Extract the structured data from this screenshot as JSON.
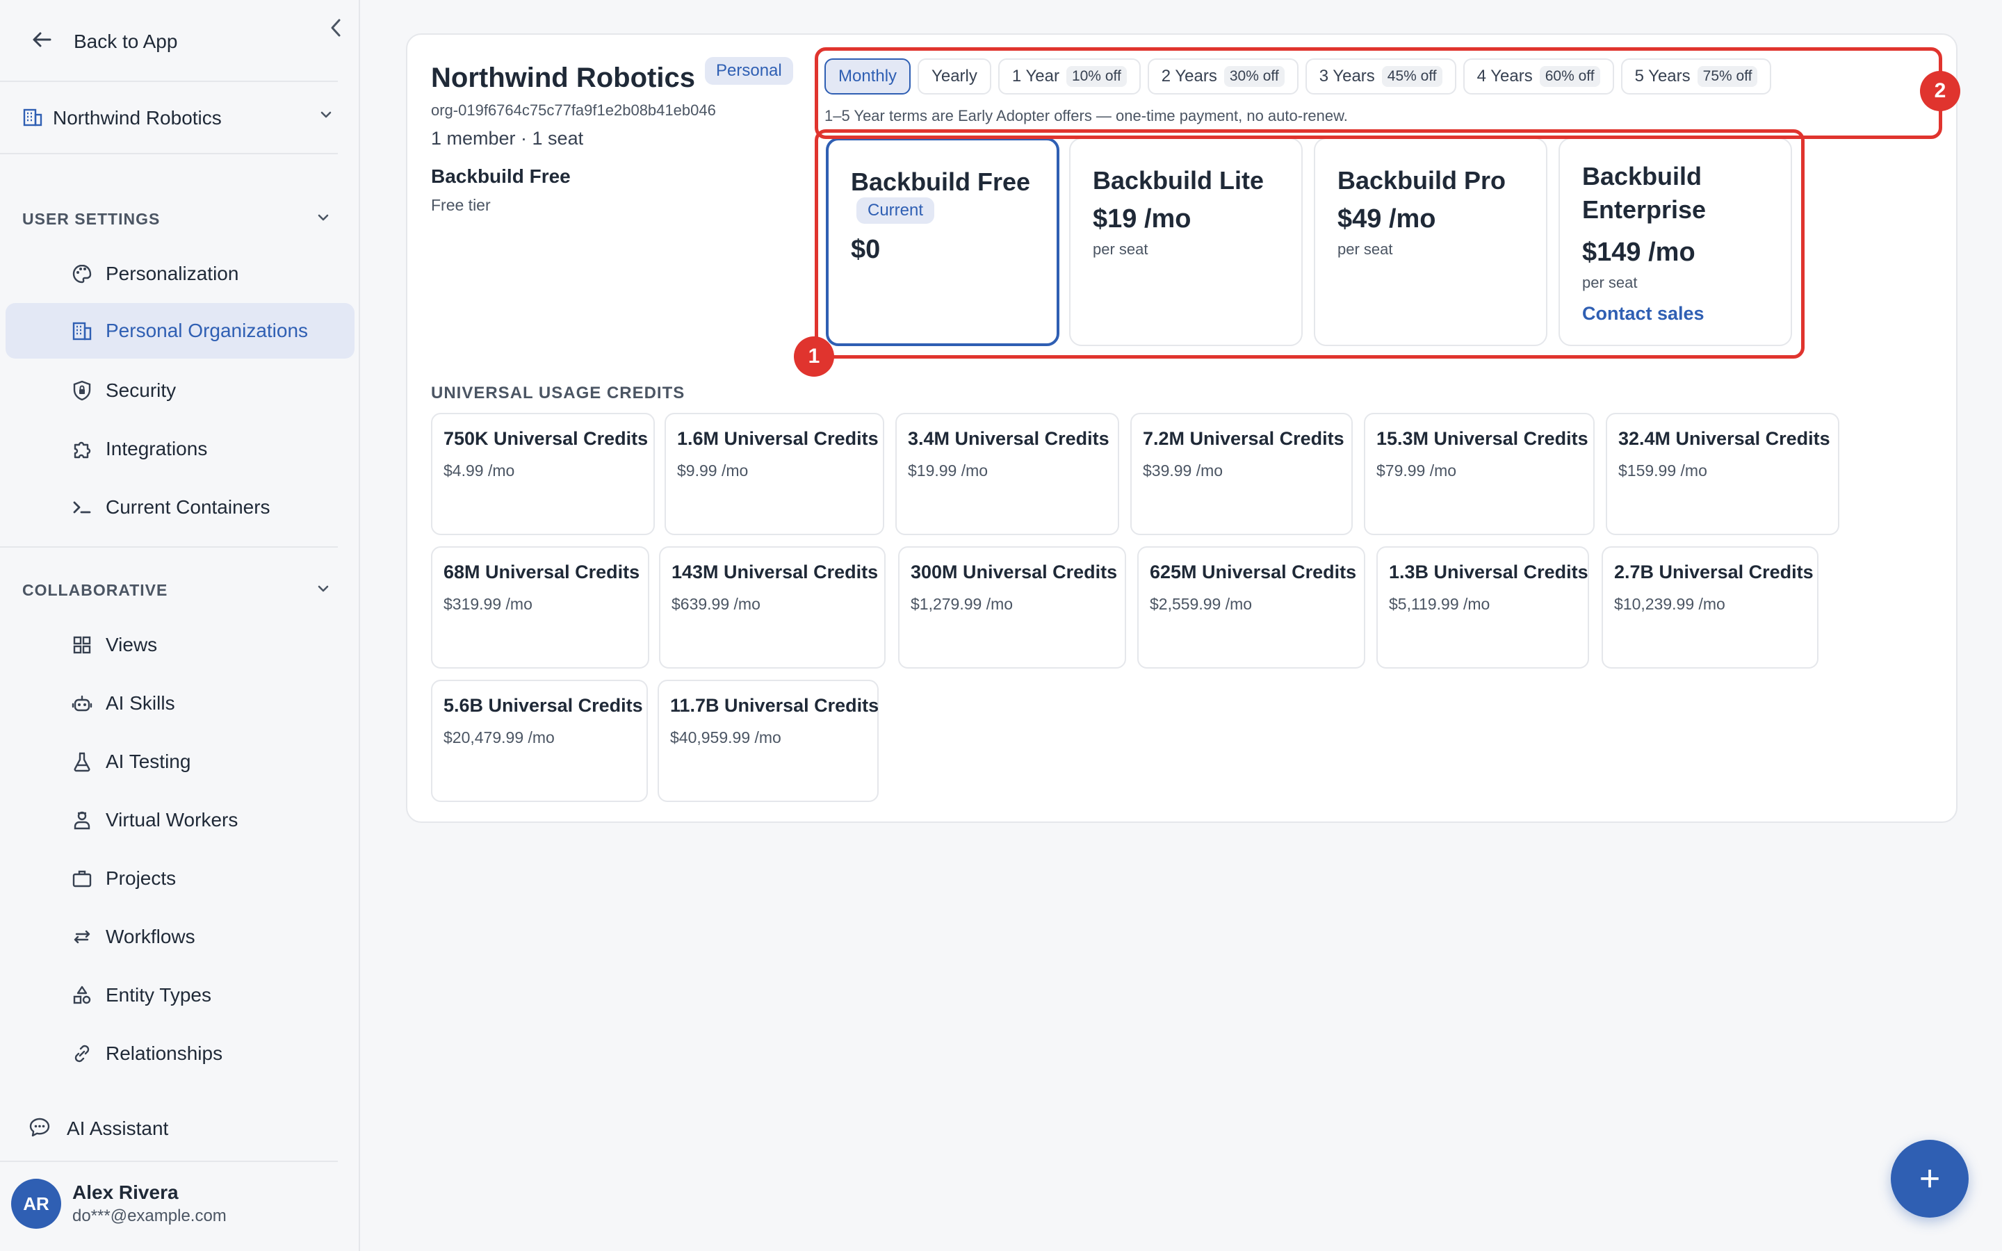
{
  "sidebar": {
    "back_label": "Back to App",
    "org_selector": "Northwind Robotics",
    "user_settings_head": "USER SETTINGS",
    "user_items": [
      {
        "label": "Personalization",
        "icon": "palette-icon"
      },
      {
        "label": "Personal Organizations",
        "icon": "building-icon"
      },
      {
        "label": "Security",
        "icon": "shield-icon"
      },
      {
        "label": "Integrations",
        "icon": "puzzle-icon"
      },
      {
        "label": "Current Containers",
        "icon": "terminal-icon"
      }
    ],
    "collab_head": "COLLABORATIVE",
    "collab_items": [
      {
        "label": "Views",
        "icon": "grid-icon"
      },
      {
        "label": "AI Skills",
        "icon": "robot-icon"
      },
      {
        "label": "AI Testing",
        "icon": "flask-icon"
      },
      {
        "label": "Virtual Workers",
        "icon": "worker-icon"
      },
      {
        "label": "Projects",
        "icon": "briefcase-icon"
      },
      {
        "label": "Workflows",
        "icon": "arrows-icon"
      },
      {
        "label": "Entity Types",
        "icon": "shapes-icon"
      },
      {
        "label": "Relationships",
        "icon": "link-icon"
      }
    ],
    "ai_assistant": "AI Assistant",
    "user": {
      "initials": "AR",
      "name": "Alex Rivera",
      "email": "do***@example.com"
    }
  },
  "org": {
    "name": "Northwind Robotics",
    "badge": "Personal",
    "id": "org-019f6764c75c77fa9f1e2b08b41eb046",
    "meta": "1 member · 1 seat",
    "plan_name": "Backbuild Free",
    "plan_sub": "Free tier"
  },
  "terms": {
    "options": [
      {
        "label": "Monthly",
        "off": ""
      },
      {
        "label": "Yearly",
        "off": ""
      },
      {
        "label": "1 Year",
        "off": "10% off"
      },
      {
        "label": "2 Years",
        "off": "30% off"
      },
      {
        "label": "3 Years",
        "off": "45% off"
      },
      {
        "label": "4 Years",
        "off": "60% off"
      },
      {
        "label": "5 Years",
        "off": "75% off"
      }
    ],
    "selected": "Monthly",
    "note": "1–5 Year terms are Early Adopter offers — one-time payment, no auto-renew."
  },
  "plans": [
    {
      "name": "Backbuild Free",
      "badge": "Current",
      "price": "$0",
      "per": ""
    },
    {
      "name": "Backbuild Lite",
      "price": "$19 /mo",
      "per": "per seat"
    },
    {
      "name": "Backbuild Pro",
      "price": "$49 /mo",
      "per": "per seat"
    },
    {
      "name_line1": "Backbuild",
      "name_line2": "Enterprise",
      "price": "$149 /mo",
      "per": "per seat",
      "contact": "Contact sales"
    }
  ],
  "annotations": {
    "one": "1",
    "two": "2"
  },
  "credits": {
    "head": "UNIVERSAL USAGE CREDITS",
    "items": [
      {
        "name": "750K Universal Credits",
        "price": "$4.99 /mo"
      },
      {
        "name": "1.6M Universal Credits",
        "price": "$9.99 /mo"
      },
      {
        "name": "3.4M Universal Credits",
        "price": "$19.99 /mo"
      },
      {
        "name": "7.2M Universal Credits",
        "price": "$39.99 /mo"
      },
      {
        "name": "15.3M Universal Credits",
        "price": "$79.99 /mo"
      },
      {
        "name": "32.4M Universal Credits",
        "price": "$159.99 /mo"
      },
      {
        "name": "68M Universal Credits",
        "price": "$319.99 /mo"
      },
      {
        "name": "143M Universal Credits",
        "price": "$639.99 /mo"
      },
      {
        "name": "300M Universal Credits",
        "price": "$1,279.99 /mo"
      },
      {
        "name": "625M Universal Credits",
        "price": "$2,559.99 /mo"
      },
      {
        "name": "1.3B Universal Credits",
        "price": "$5,119.99 /mo"
      },
      {
        "name": "2.7B Universal Credits",
        "price": "$10,239.99 /mo"
      },
      {
        "name": "5.6B Universal Credits",
        "price": "$20,479.99 /mo"
      },
      {
        "name": "11.7B Universal Credits",
        "price": "$40,959.99 /mo"
      }
    ]
  },
  "fab_label": "+",
  "colors": {
    "accent": "#2f5fb3",
    "annotation": "#e0342e",
    "active_bg": "#e3e8f5"
  }
}
